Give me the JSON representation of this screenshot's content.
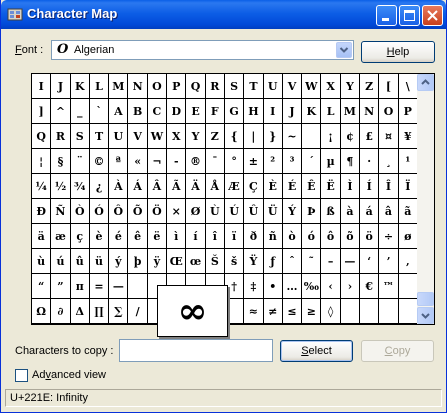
{
  "window": {
    "title": "Character Map"
  },
  "font": {
    "label_prefix": "F",
    "label_rest": "ont :",
    "selected": "Algerian",
    "icon": "O"
  },
  "buttons": {
    "help_u": "H",
    "help_rest": "elp",
    "select_u": "S",
    "select_rest": "elect",
    "copy_u": "C",
    "copy_rest": "opy"
  },
  "grid": {
    "rows": [
      [
        "I",
        "J",
        "K",
        "L",
        "M",
        "N",
        "O",
        "P",
        "Q",
        "R",
        "S",
        "T",
        "U",
        "V",
        "W",
        "X",
        "Y",
        "Z",
        "[",
        "\\"
      ],
      [
        "]",
        "^",
        "_",
        "`",
        "A",
        "B",
        "C",
        "D",
        "E",
        "F",
        "G",
        "H",
        "I",
        "J",
        "K",
        "L",
        "M",
        "N",
        "O",
        "P"
      ],
      [
        "Q",
        "R",
        "S",
        "T",
        "U",
        "V",
        "W",
        "X",
        "Y",
        "Z",
        "{",
        "|",
        "}",
        "~",
        "",
        "¡",
        "¢",
        "£",
        "¤",
        "¥"
      ],
      [
        "¦",
        "§",
        "¨",
        "©",
        "ª",
        "«",
        "¬",
        "-",
        "®",
        "¯",
        "°",
        "±",
        "²",
        "³",
        "´",
        "µ",
        "¶",
        "·",
        "¸",
        "¹"
      ],
      [
        "¼",
        "½",
        "¾",
        "¿",
        "À",
        "Á",
        "Â",
        "Ã",
        "Ä",
        "Å",
        "Æ",
        "Ç",
        "È",
        "É",
        "Ê",
        "Ë",
        "Ì",
        "Í",
        "Î",
        "Ï"
      ],
      [
        "Ð",
        "Ñ",
        "Ò",
        "Ó",
        "Ô",
        "Õ",
        "Ö",
        "×",
        "Ø",
        "Ù",
        "Ú",
        "Û",
        "Ü",
        "Ý",
        "Þ",
        "ß",
        "à",
        "á",
        "â",
        "ã"
      ],
      [
        "ä",
        "æ",
        "ç",
        "è",
        "é",
        "ê",
        "ë",
        "ì",
        "í",
        "î",
        "ï",
        "ð",
        "ñ",
        "ò",
        "ó",
        "ô",
        "õ",
        "ö",
        "÷",
        "ø"
      ],
      [
        "ù",
        "ú",
        "û",
        "ü",
        "ý",
        "þ",
        "ÿ",
        "Œ",
        "œ",
        "Š",
        "š",
        "Ÿ",
        "ƒ",
        "ˆ",
        "˜",
        "–",
        "—",
        "‘",
        "’",
        "‚"
      ],
      [
        "“",
        "”",
        "π",
        "=",
        "—",
        "",
        "",
        "",
        "",
        "",
        "†",
        "‡",
        "•",
        "…",
        "‰",
        "‹",
        "›",
        "€",
        "™",
        ""
      ],
      [
        "Ω",
        "∂",
        "Δ",
        "∏",
        "∑",
        "/",
        "",
        "",
        "",
        "",
        "",
        "≈",
        "≠",
        "≤",
        "≥",
        "◊",
        "",
        "",
        "",
        ""
      ]
    ]
  },
  "zoom_char": "∞",
  "copy": {
    "label": "Characters to copy :",
    "value": ""
  },
  "advanced": {
    "label_prefix": "Ad",
    "label_u": "v",
    "label_rest": "anced view"
  },
  "status": "U+221E: Infinity"
}
